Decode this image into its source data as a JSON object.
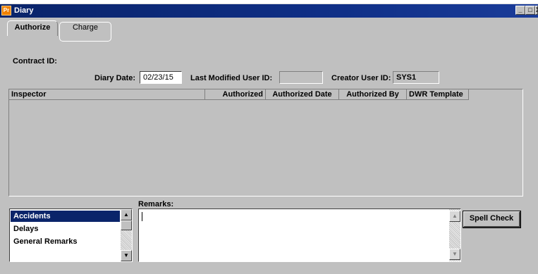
{
  "window": {
    "app_icon": "Pr",
    "title": "Diary",
    "minimize": "_",
    "maximize": "□",
    "close": "X"
  },
  "tabs": [
    {
      "label": "Authorize",
      "active": true
    },
    {
      "label": "Charge",
      "active": false
    }
  ],
  "form": {
    "contract_id_label": "Contract ID:",
    "diary_date_label": "Diary Date:",
    "diary_date_value": "02/23/15",
    "last_modified_label": "Last Modified User ID:",
    "last_modified_value": "",
    "creator_label": "Creator User ID:",
    "creator_value": "SYS1"
  },
  "grid": {
    "columns": [
      "Inspector",
      "Authorized",
      "Authorized Date",
      "Authorized By",
      "DWR Template"
    ],
    "rows": []
  },
  "remarks_types": {
    "items": [
      "Accidents",
      "Delays",
      "General Remarks"
    ],
    "selected": "Accidents"
  },
  "remarks": {
    "label": "Remarks:",
    "value": ""
  },
  "buttons": {
    "spell_check": "Spell Check"
  },
  "icons": {
    "scroll_up": "up-arrow-icon",
    "scroll_down": "down-arrow-icon"
  },
  "colors": {
    "window_bg": "#c0c0c0",
    "titlebar": "#0a246a",
    "selection": "#0a246a"
  }
}
